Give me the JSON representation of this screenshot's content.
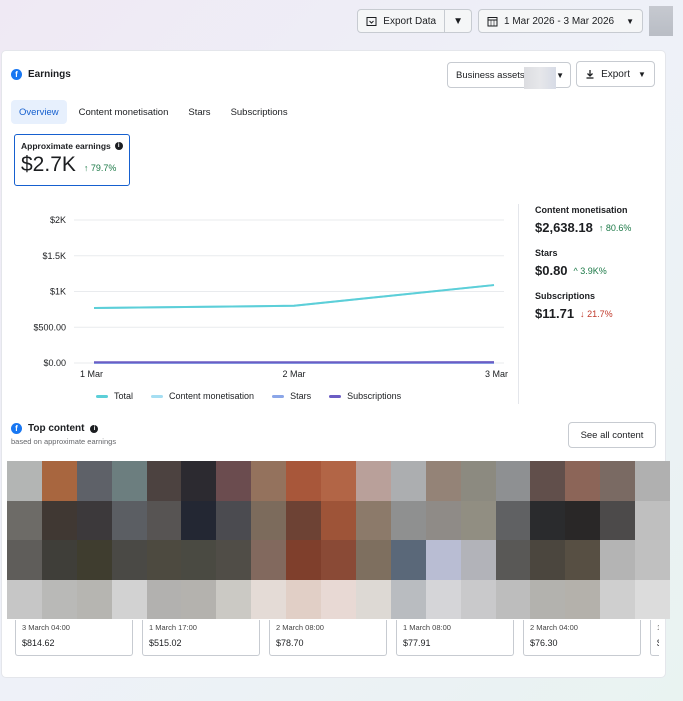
{
  "topbar": {
    "export_data_label": "Export Data",
    "date_range_label": "1 Mar 2026 - 3 Mar 2026"
  },
  "header": {
    "title": "Earnings",
    "business_assets_label": "Business assets",
    "export_label": "Export"
  },
  "tabs": [
    {
      "label": "Overview",
      "active": true
    },
    {
      "label": "Content monetisation",
      "active": false
    },
    {
      "label": "Stars",
      "active": false
    },
    {
      "label": "Subscriptions",
      "active": false
    }
  ],
  "kpi": {
    "label": "Approximate earnings",
    "value": "$2.7K",
    "change": "79.7%"
  },
  "breakdown": [
    {
      "title": "Content monetisation",
      "value": "$2,638.18",
      "change": "80.6%",
      "direction": "up"
    },
    {
      "title": "Stars",
      "value": "$0.80",
      "change": "3.9K%",
      "direction": "up"
    },
    {
      "title": "Subscriptions",
      "value": "$11.71",
      "change": "21.7%",
      "direction": "down"
    }
  ],
  "chart_data": {
    "type": "line",
    "x": [
      "1 Mar",
      "2 Mar",
      "3 Mar"
    ],
    "y_ticks": [
      "$0.00",
      "$500.00",
      "$1K",
      "$1.5K",
      "$2K"
    ],
    "ylim": [
      0,
      2000
    ],
    "series": [
      {
        "name": "Total",
        "color": "#5ccfd8",
        "values": [
          770,
          800,
          1090
        ]
      },
      {
        "name": "Content monetisation",
        "color": "#a5def2",
        "values": [
          770,
          800,
          1090
        ]
      },
      {
        "name": "Stars",
        "color": "#8ba6e8",
        "values": [
          0,
          0,
          0
        ]
      },
      {
        "name": "Subscriptions",
        "color": "#6b5dc4",
        "values": [
          10,
          10,
          12
        ]
      }
    ],
    "legend": "bottom"
  },
  "top_content": {
    "title": "Top content",
    "subtitle": "based on approximate earnings",
    "see_all_label": "See all content",
    "items": [
      {
        "date": "3 March 04:00",
        "amount": "$814.62"
      },
      {
        "date": "1 March 17:00",
        "amount": "$515.02"
      },
      {
        "date": "2 March 08:00",
        "amount": "$78.70"
      },
      {
        "date": "1 March 08:00",
        "amount": "$77.91"
      },
      {
        "date": "2 March 04:00",
        "amount": "$76.30"
      },
      {
        "date": "1 M",
        "amount": "$("
      }
    ]
  },
  "colors": {
    "accent": "#1660cf",
    "positive": "#1d7a48",
    "negative": "#c0392b"
  }
}
